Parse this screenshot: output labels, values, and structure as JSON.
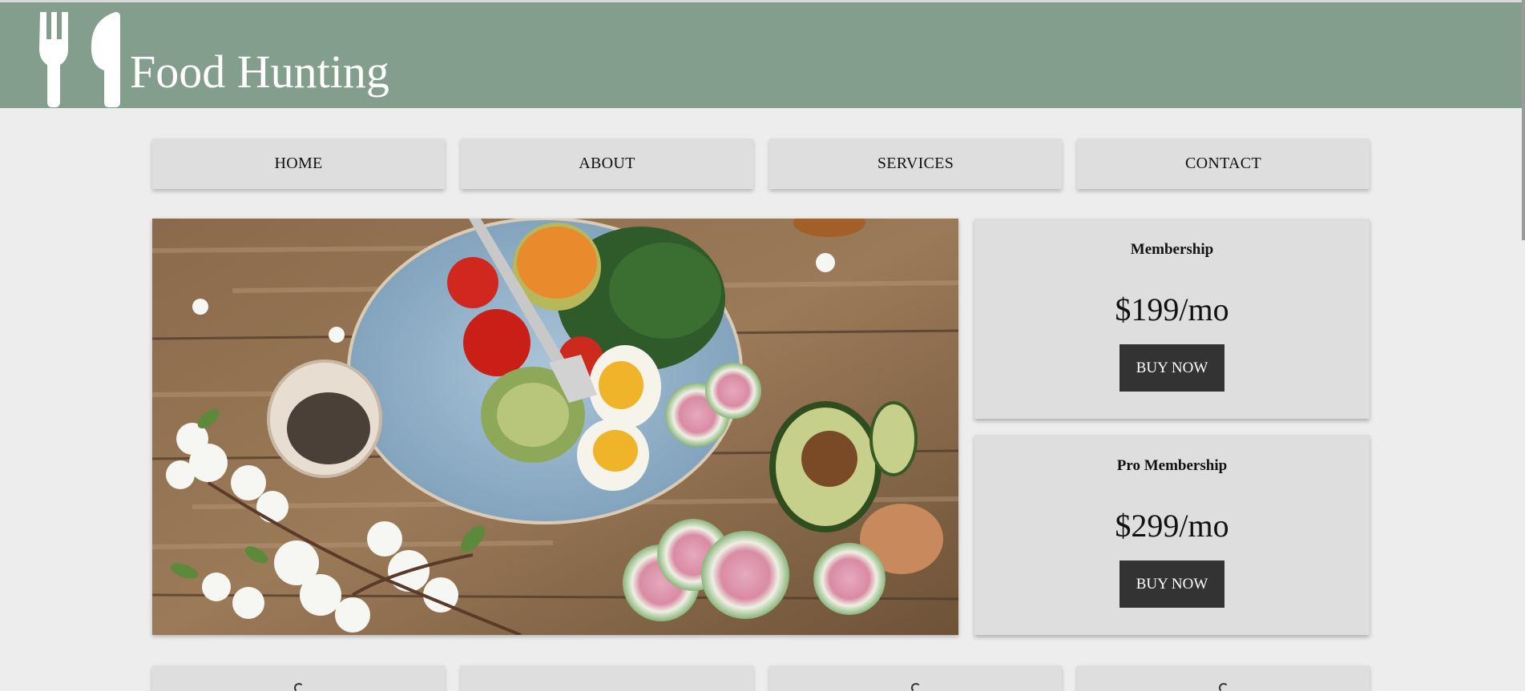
{
  "header": {
    "title": "Food Hunting",
    "logo_icon": "fork-knife-icon",
    "background_color": "#839e8d"
  },
  "nav": {
    "items": [
      {
        "label": "HOME"
      },
      {
        "label": "ABOUT"
      },
      {
        "label": "SERVICES"
      },
      {
        "label": "CONTACT"
      }
    ]
  },
  "hero": {
    "image": "salad-bowl-on-wooden-table-photo"
  },
  "pricing": [
    {
      "title": "Membership",
      "price": "$199/mo",
      "button_label": "BUY NOW"
    },
    {
      "title": "Pro Membership",
      "price": "$299/mo",
      "button_label": "BUY NOW"
    }
  ],
  "colors": {
    "page_background": "#ededed",
    "card_background": "#dedede",
    "button_background": "#333333",
    "button_text": "#ffffff"
  }
}
